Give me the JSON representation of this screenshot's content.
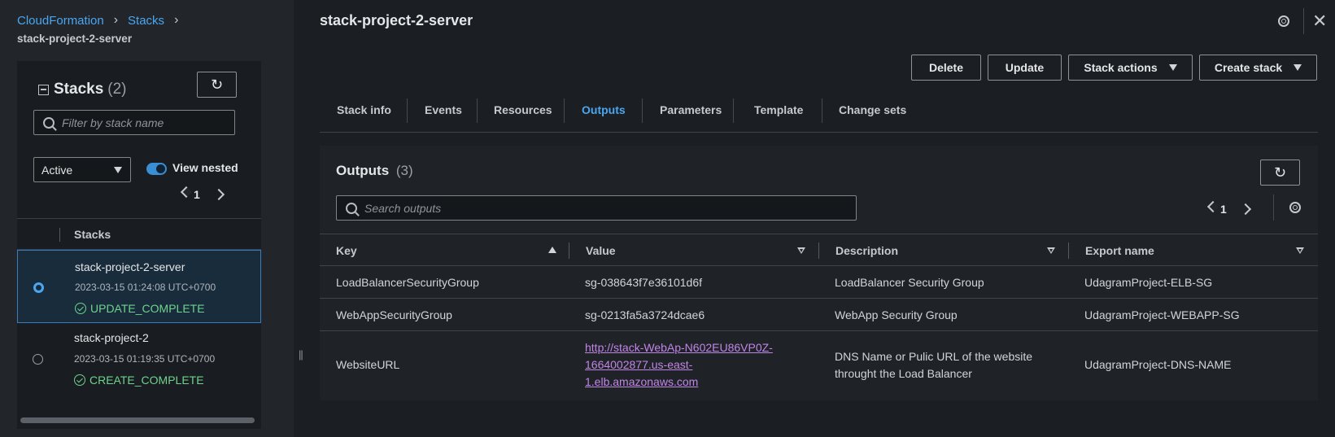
{
  "breadcrumb": {
    "items": [
      "CloudFormation",
      "Stacks"
    ],
    "current": "stack-project-2-server"
  },
  "stacks_panel": {
    "title": "Stacks",
    "count": "(2)",
    "search_placeholder": "Filter by stack name",
    "filter_value": "Active",
    "view_nested_label": "View nested",
    "view_nested_on": true,
    "page": "1",
    "column_header": "Stacks",
    "rows": [
      {
        "name": "stack-project-2-server",
        "date": "2023-03-15 01:24:08 UTC+0700",
        "status": "UPDATE_COMPLETE",
        "selected": true
      },
      {
        "name": "stack-project-2",
        "date": "2023-03-15 01:19:35 UTC+0700",
        "status": "CREATE_COMPLETE",
        "selected": false
      }
    ]
  },
  "header": {
    "title": "stack-project-2-server"
  },
  "actions": {
    "delete": "Delete",
    "update": "Update",
    "stack_actions": "Stack actions",
    "create_stack": "Create stack"
  },
  "tabs": [
    "Stack info",
    "Events",
    "Resources",
    "Outputs",
    "Parameters",
    "Template",
    "Change sets"
  ],
  "active_tab": "Outputs",
  "outputs": {
    "title": "Outputs",
    "count": "(3)",
    "search_placeholder": "Search outputs",
    "page": "1",
    "columns": [
      "Key",
      "Value",
      "Description",
      "Export name"
    ],
    "rows": [
      {
        "key": "LoadBalancerSecurityGroup",
        "value": "sg-038643f7e36101d6f",
        "description": "LoadBalancer Security Group",
        "export": "UdagramProject-ELB-SG"
      },
      {
        "key": "WebAppSecurityGroup",
        "value": "sg-0213fa5a3724dcae6",
        "description": "WebApp Security Group",
        "export": "UdagramProject-WEBAPP-SG"
      },
      {
        "key": "WebsiteURL",
        "value_lines": [
          "http://stack-WebAp-N602EU86VP0Z-",
          "1664002877.us-east-",
          "1.elb.amazonaws.com"
        ],
        "description_lines": [
          "DNS Name or Pulic URL of the website",
          "throught the Load Balancer"
        ],
        "export": "UdagramProject-DNS-NAME"
      }
    ]
  },
  "colors": {
    "link": "#4aa6f0",
    "success": "#6ed38e",
    "visited_link": "#c185e6"
  }
}
